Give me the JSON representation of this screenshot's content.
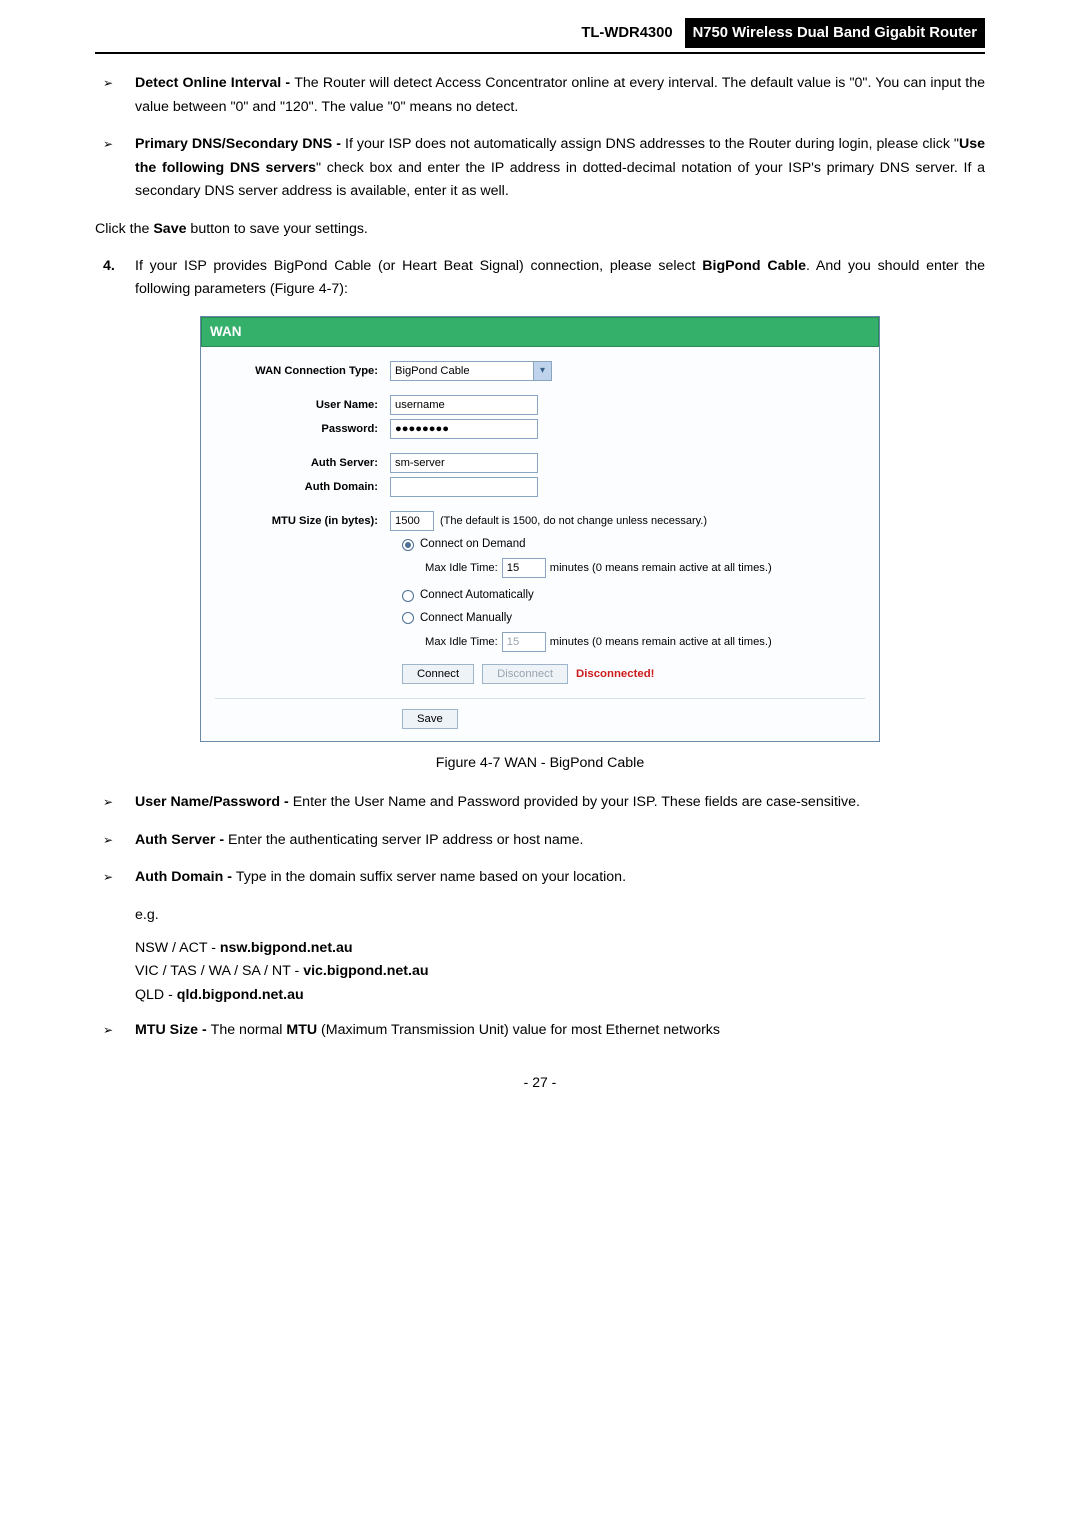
{
  "header": {
    "model": "TL-WDR4300",
    "title": "N750 Wireless Dual Band Gigabit Router"
  },
  "bullet1": {
    "strong": "Detect Online Interval - ",
    "rest": "The Router will detect Access Concentrator online at every interval. The default value is \"0\". You can input the value between \"0\" and \"120\". The value \"0\" means no detect."
  },
  "bullet2": {
    "strong": "Primary DNS/Secondary DNS - ",
    "seg1": "If your ISP does not automatically assign DNS addresses to the Router during login, please click \"",
    "boldA": "Use the following DNS servers",
    "seg2": "\" check box and enter the IP address in dotted-decimal notation of your ISP's primary DNS server. If a secondary DNS server address is available, enter it as well."
  },
  "save_line": {
    "pre": "Click the ",
    "bold": "Save",
    "post": " button to save your settings."
  },
  "step4": {
    "num": "4.",
    "seg1": "If your ISP provides BigPond Cable (or Heart Beat Signal) connection, please select ",
    "bold": "BigPond Cable",
    "seg2": ". And you should enter the following parameters (Figure 4-7):"
  },
  "wan": {
    "title": "WAN",
    "labels": {
      "conn_type": "WAN Connection Type:",
      "user": "User Name:",
      "pass": "Password:",
      "auth_server": "Auth Server:",
      "auth_domain": "Auth Domain:",
      "mtu": "MTU Size (in bytes):"
    },
    "conn_value": "BigPond Cable",
    "user_value": "username",
    "pass_value": "●●●●●●●●",
    "authserver_value": "sm-server",
    "authdomain_value": "",
    "mtu_value": "1500",
    "mtu_hint": "(The default is 1500, do not change unless necessary.)",
    "radio1": "Connect on Demand",
    "idle_label": "Max Idle Time:",
    "idle_value1": "15",
    "idle_hint": "minutes (0 means remain active at all times.)",
    "radio2": "Connect Automatically",
    "radio3": "Connect Manually",
    "idle_value2": "15",
    "btn_connect": "Connect",
    "btn_disconnect": "Disconnect",
    "status": "Disconnected!",
    "btn_save": "Save"
  },
  "fig_caption": "Figure 4-7 WAN - BigPond Cable",
  "bulletA": {
    "strong": "User Name/Password - ",
    "rest": "Enter the User Name and Password provided by your ISP. These fields are case-sensitive."
  },
  "bulletB": {
    "strong": "Auth Server - ",
    "rest": "Enter the authenticating server IP address or host name."
  },
  "bulletC": {
    "strong": "Auth Domain - ",
    "rest": "Type in the domain suffix server name based on your location."
  },
  "eg": "e.g.",
  "dom1": {
    "pre": "NSW / ACT - ",
    "bold": "nsw.bigpond.net.au"
  },
  "dom2": {
    "pre": "VIC / TAS / WA / SA / NT - ",
    "bold": "vic.bigpond.net.au"
  },
  "dom3": {
    "pre": "QLD - ",
    "bold": "qld.bigpond.net.au"
  },
  "bulletD": {
    "strong": "MTU Size - ",
    "seg1": "The normal ",
    "bold": "MTU",
    "seg2": " (Maximum Transmission Unit) value for most Ethernet networks"
  },
  "pagenum": "- 27 -"
}
